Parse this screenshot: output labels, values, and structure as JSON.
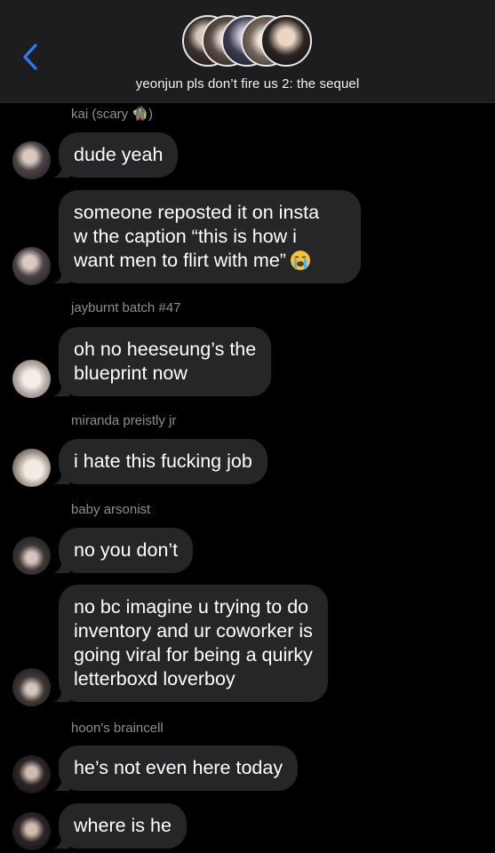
{
  "header": {
    "title": "yeonjun pls don’t fire us 2: the sequel",
    "back_icon": "chevron-left-icon",
    "accent_color": "#2f7cf6"
  },
  "messages": [
    {
      "sender": "kai (scary 🧌)",
      "text_lines": [
        "dude yeah"
      ]
    },
    {
      "sender": "",
      "text_lines": [
        "someone reposted it on insta",
        "w the caption “this is how i",
        "want men to flirt with me”"
      ],
      "emoji": "loudly-crying-face-icon"
    },
    {
      "sender": "jayburnt batch #47",
      "text_lines": [
        "oh no heeseung’s the",
        "blueprint now"
      ]
    },
    {
      "sender": "miranda preistly jr",
      "text_lines": [
        "i hate this fucking job"
      ]
    },
    {
      "sender": "baby arsonist",
      "text_lines": [
        "no you don’t"
      ]
    },
    {
      "sender": "",
      "text_lines": [
        "no bc imagine u trying to do",
        "inventory and ur coworker is",
        "going viral for being a quirky",
        "letterboxd loverboy"
      ]
    },
    {
      "sender": "hoon's braincell",
      "text_lines": [
        "he’s not even here today"
      ]
    },
    {
      "sender": "",
      "text_lines": [
        "where is he"
      ]
    }
  ],
  "colors": {
    "bubble": "#262628",
    "background": "#000000",
    "sender_label": "#8e8e93"
  }
}
